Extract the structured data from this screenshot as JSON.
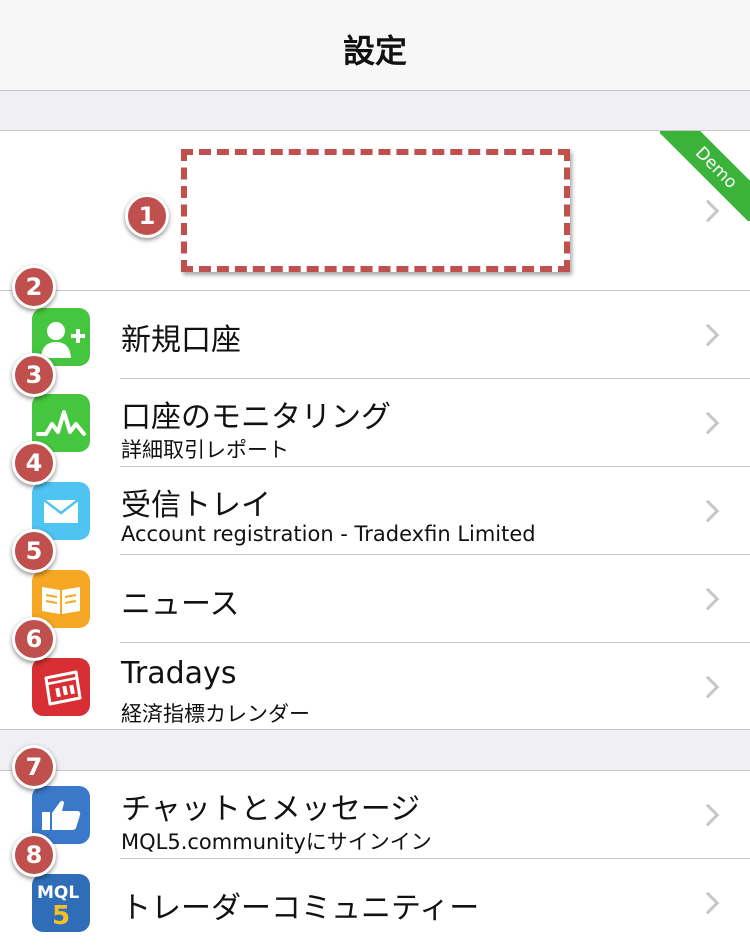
{
  "navbar": {
    "title": "設定"
  },
  "account": {
    "ribbon": "Demo",
    "badge": "1"
  },
  "items": [
    {
      "badge": "2",
      "icon": "add-user-icon",
      "color": "#46c63e",
      "label": "新規口座",
      "sub": ""
    },
    {
      "badge": "3",
      "icon": "monitoring-chart-icon",
      "color": "#46c63e",
      "label": "口座のモニタリング",
      "sub": "詳細取引レポート"
    },
    {
      "badge": "4",
      "icon": "mail-icon",
      "color": "#4fc3f2",
      "label": "受信トレイ",
      "sub": "Account registration - Tradexfin Limited"
    },
    {
      "badge": "5",
      "icon": "news-book-icon",
      "color": "#f6a724",
      "label": "ニュース",
      "sub": ""
    },
    {
      "badge": "6",
      "icon": "calendar-icon",
      "color": "#d72f34",
      "label": "Tradays",
      "sub": "経済指標カレンダー"
    },
    {
      "badge": "7",
      "icon": "thumbs-up-icon",
      "color": "#3a78c9",
      "label": "チャットとメッセージ",
      "sub": "MQL5.communityにサインイン"
    },
    {
      "badge": "8",
      "icon": "mql5-logo-icon",
      "color": "#2f6db9",
      "label": "トレーダーコミュニティー",
      "sub": ""
    }
  ],
  "mql5_logo": {
    "top": "MQL",
    "bottom": "5"
  }
}
